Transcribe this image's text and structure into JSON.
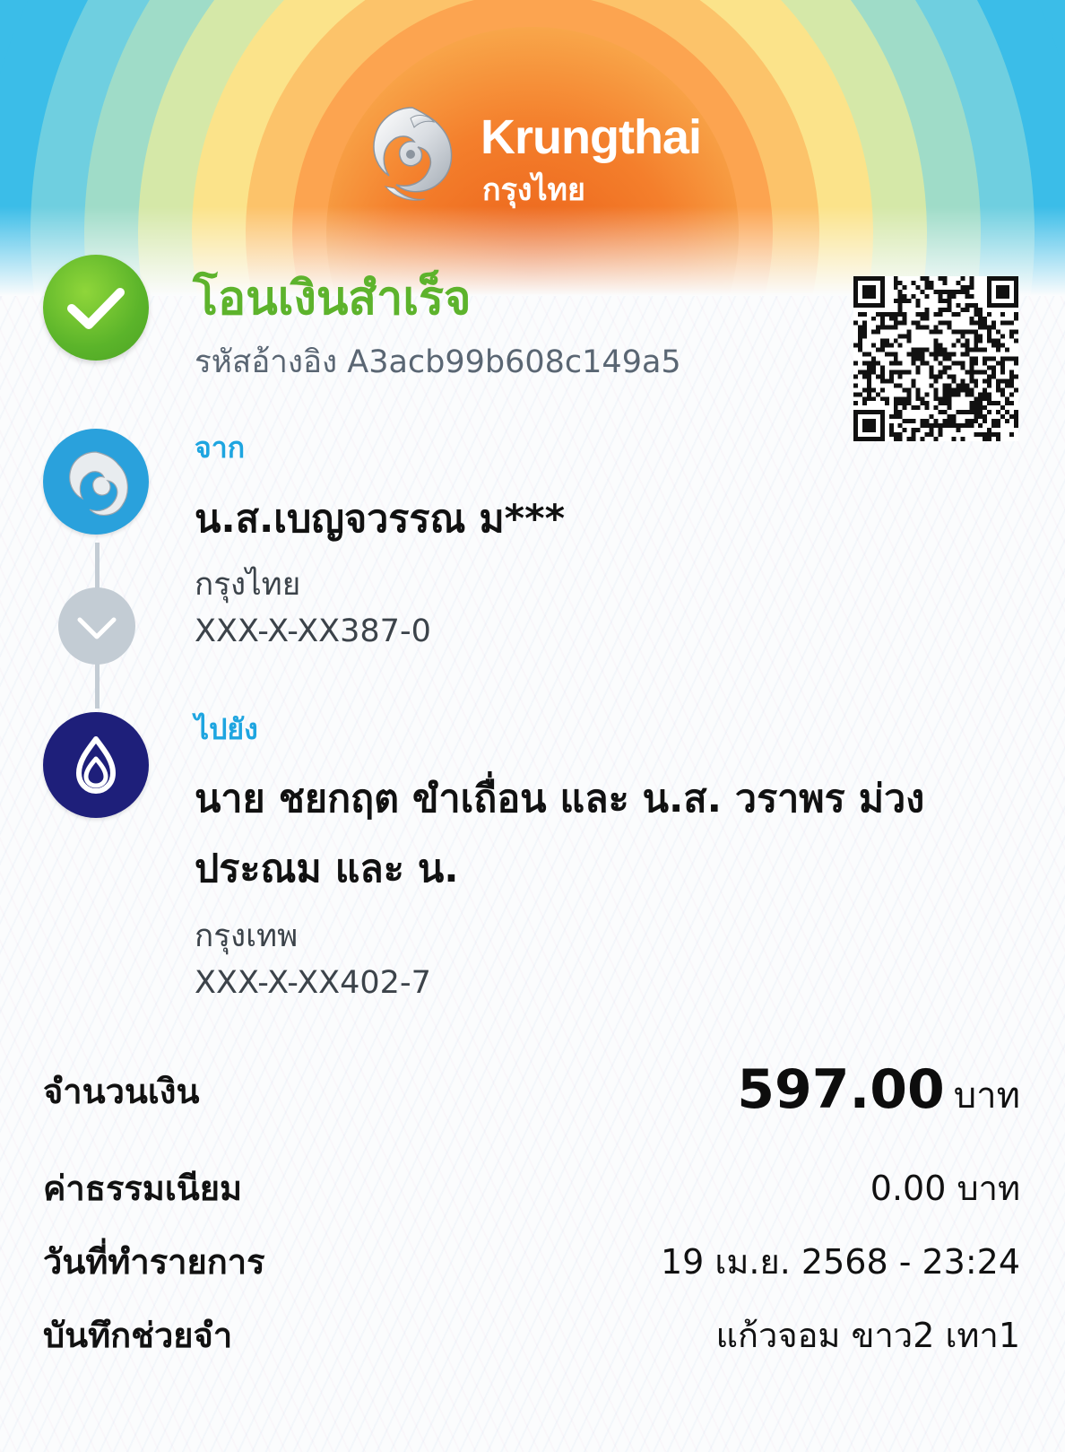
{
  "brand": {
    "name_en": "Krungthai",
    "name_th": "กรุงไทย"
  },
  "status": {
    "title": "โอนเงินสำเร็จ",
    "ref_label": "รหัสอ้างอิง",
    "ref_code": "A3acb99b608c149a5",
    "icon": "check-icon",
    "color": "#5db32c"
  },
  "from": {
    "label": "จาก",
    "name": "น.ส.เบญจวรรณ ม***",
    "bank": "กรุงไทย",
    "account": "XXX-X-XX387-0",
    "bank_color": "#2aa1dc"
  },
  "to": {
    "label": "ไปยัง",
    "name": "นาย ชยกฤต ขำเถื่อน และ น.ส. วราพร ม่วงประณม และ น.",
    "bank": "กรุงเทพ",
    "account": "XXX-X-XX402-7",
    "bank_color": "#1e1f7a"
  },
  "details": {
    "amount_label": "จำนวนเงิน",
    "amount_value": "597.00",
    "amount_unit": "บาท",
    "fee_label": "ค่าธรรมเนียม",
    "fee_value": "0.00 บาท",
    "date_label": "วันที่ทำรายการ",
    "date_value": "19 เม.ย. 2568 - 23:24",
    "memo_label": "บันทึกช่วยจำ",
    "memo_value": "แก้วจอม ขาว2 เทา1"
  }
}
